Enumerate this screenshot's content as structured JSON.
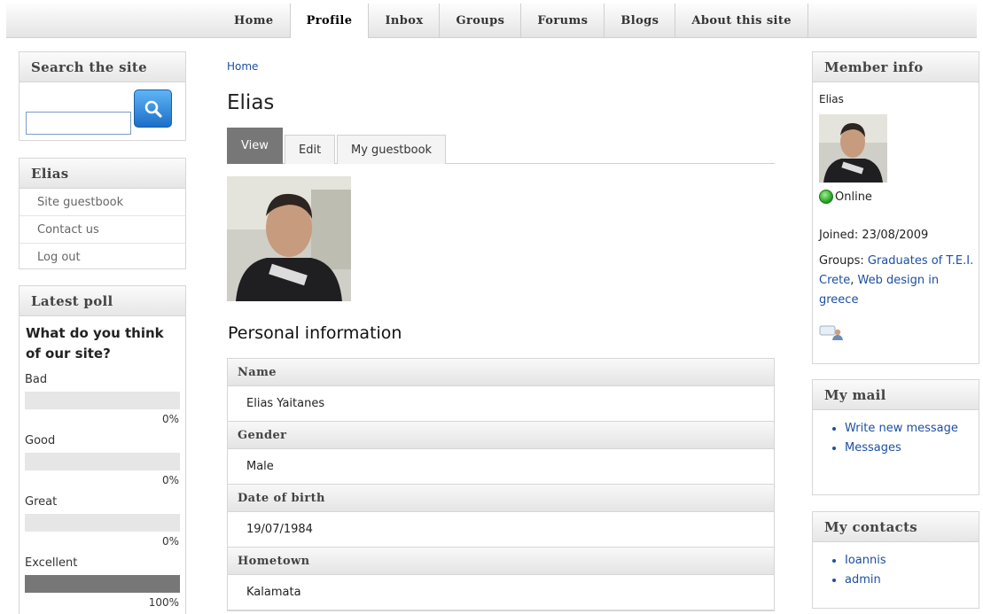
{
  "nav": {
    "items": [
      {
        "label": "Home",
        "active": false
      },
      {
        "label": "Profile",
        "active": true
      },
      {
        "label": "Inbox",
        "active": false
      },
      {
        "label": "Groups",
        "active": false
      },
      {
        "label": "Forums",
        "active": false
      },
      {
        "label": "Blogs",
        "active": false
      },
      {
        "label": "About this site",
        "active": false
      }
    ]
  },
  "search": {
    "title": "Search the site",
    "placeholder": "",
    "button_icon": "search-icon"
  },
  "user_block": {
    "title": "Elias",
    "items": [
      "Site guestbook",
      "Contact us",
      "Log out"
    ]
  },
  "poll": {
    "title": "Latest poll",
    "question": "What do you think of our site?",
    "choices": [
      {
        "label": "Bad",
        "percent": "0%",
        "fraction": 0
      },
      {
        "label": "Good",
        "percent": "0%",
        "fraction": 0
      },
      {
        "label": "Great",
        "percent": "0%",
        "fraction": 0
      },
      {
        "label": "Excellent",
        "percent": "100%",
        "fraction": 1
      }
    ]
  },
  "main": {
    "breadcrumb": "Home",
    "title": "Elias",
    "tabs": [
      {
        "label": "View",
        "active": true
      },
      {
        "label": "Edit",
        "active": false
      },
      {
        "label": "My guestbook",
        "active": false
      }
    ],
    "section_title": "Personal information",
    "fields": [
      {
        "label": "Name",
        "value": "Elias Yaitanes"
      },
      {
        "label": "Gender",
        "value": "Male"
      },
      {
        "label": "Date of birth",
        "value": "19/07/1984"
      },
      {
        "label": "Hometown",
        "value": "Kalamata"
      }
    ]
  },
  "member": {
    "title": "Member info",
    "name": "Elias",
    "status": "Online",
    "joined": "Joined: 23/08/2009",
    "groups_label": "Groups: ",
    "groups": [
      "Graduates of T.E.I. Crete",
      "Web design in greece"
    ],
    "contact_icon": "add-contact-icon"
  },
  "mail": {
    "title": "My mail",
    "items": [
      "Write new message",
      "Messages"
    ]
  },
  "contacts": {
    "title": "My contacts",
    "items": [
      "Ioannis",
      "admin"
    ]
  },
  "colors": {
    "accent": "#1d4fa1",
    "active_tab": "#777777",
    "online": "#1c9a1c",
    "search_button": "#1b6fc8"
  }
}
